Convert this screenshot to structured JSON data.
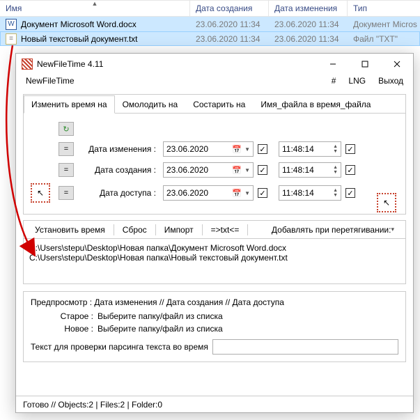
{
  "explorer": {
    "columns": {
      "name": "Имя",
      "created": "Дата создания",
      "modified": "Дата изменения",
      "type": "Тип"
    },
    "rows": [
      {
        "label": "Документ Microsoft Word.docx",
        "created": "23.06.2020 11:34",
        "modified": "23.06.2020 11:34",
        "type": "Документ Micros"
      },
      {
        "label": "Новый текстовый документ.txt",
        "created": "23.06.2020 11:34",
        "modified": "23.06.2020 11:34",
        "type": "Файл \"TXT\""
      }
    ]
  },
  "window": {
    "title": "NewFileTime 4.11",
    "menuLeft": "NewFileTime",
    "menuRight": {
      "hash": "#",
      "lng": "LNG",
      "exit": "Выход"
    }
  },
  "tabs": {
    "change": "Изменить время на",
    "younger": "Омолодить на",
    "older": "Состарить на",
    "nametime": "Имя_файла в время_файла"
  },
  "labels": {
    "modified": "Дата изменения :",
    "created": "Дата создания :",
    "accessed": "Дата доступа :"
  },
  "values": {
    "date": "23.06.2020",
    "time": "11:48:14",
    "eq": "="
  },
  "actions": {
    "set": "Установить время",
    "reset": "Сброс",
    "import": "Импорт",
    "txtop": "=>txt<=",
    "adddrag": "Добавлять при перетягивании:"
  },
  "paths": {
    "p1": "C:\\Users\\stepu\\Desktop\\Новая папка\\Документ Microsoft Word.docx",
    "p2": "C:\\Users\\stepu\\Desktop\\Новая папка\\Новый текстовый документ.txt"
  },
  "preview": {
    "header": "Предпросмотр :   Дата изменения   //   Дата создания   //   Дата доступа",
    "oldKey": "Старое :",
    "newKey": "Новое :",
    "oldVal": "Выберите папку/файл из списка",
    "newVal": "Выберите папку/файл из списка",
    "parseLabel": "Текст для проверки парсинга текста во время"
  },
  "status": "Готово // Objects:2 | Files:2  |  Folder:0"
}
